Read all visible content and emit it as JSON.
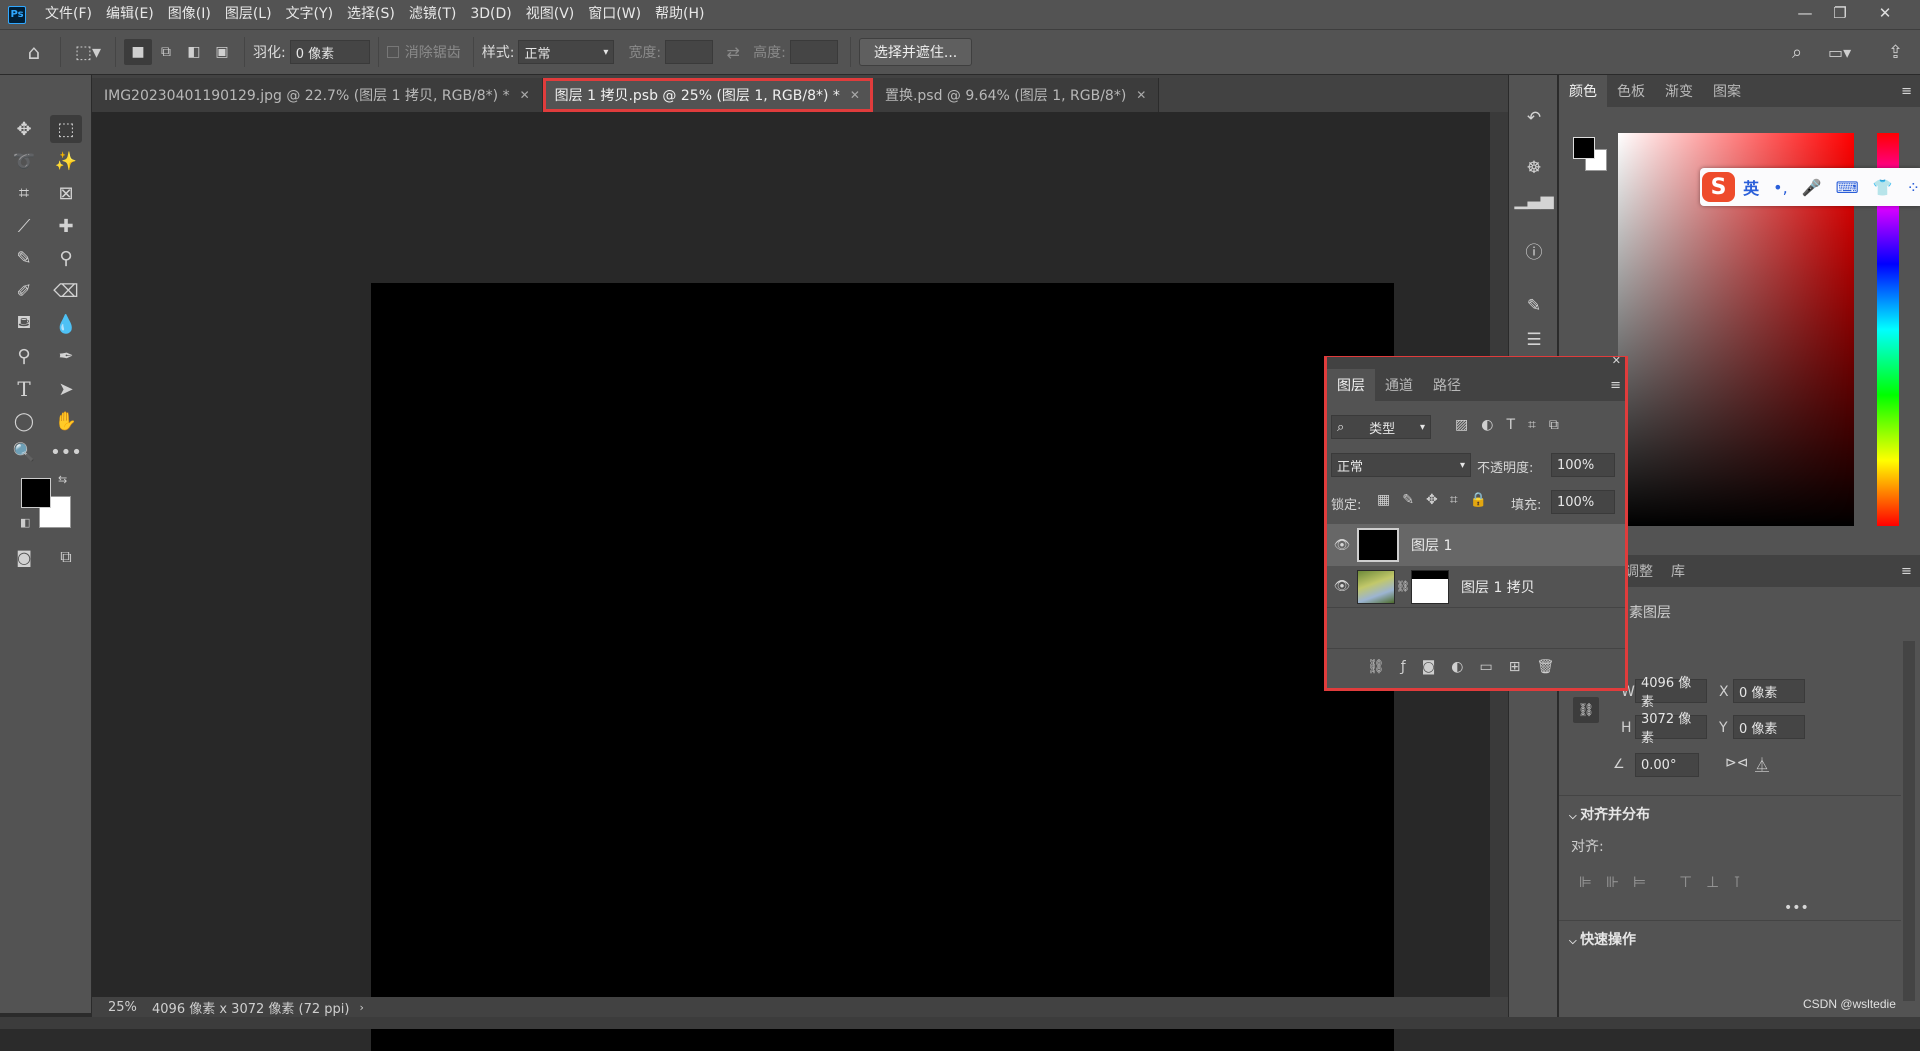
{
  "app": {
    "logo": "Ps"
  },
  "menu": [
    "文件(F)",
    "编辑(E)",
    "图像(I)",
    "图层(L)",
    "文字(Y)",
    "选择(S)",
    "滤镜(T)",
    "3D(D)",
    "视图(V)",
    "窗口(W)",
    "帮助(H)"
  ],
  "options": {
    "feather_label": "羽化:",
    "feather_value": "0 像素",
    "antialias_label": "消除锯齿",
    "style_label": "样式:",
    "style_value": "正常",
    "width_label": "宽度:",
    "height_label": "高度:",
    "select_mask_button": "选择并遮住..."
  },
  "tabs": [
    {
      "label": "IMG20230401190129.jpg @ 22.7% (图层 1 拷贝, RGB/8*) *"
    },
    {
      "label": "图层 1 拷贝.psb @ 25% (图层 1, RGB/8*) *"
    },
    {
      "label": "置换.psd @ 9.64% (图层 1, RGB/8*)"
    }
  ],
  "status": {
    "zoom": "25%",
    "doc_size": "4096 像素 x 3072 像素 (72 ppi)"
  },
  "color_panel": {
    "tabs": [
      "颜色",
      "色板",
      "渐变",
      "图案"
    ]
  },
  "ime": {
    "mode": "英"
  },
  "layers_panel": {
    "tabs": [
      "图层",
      "通道",
      "路径"
    ],
    "filter_label": "类型",
    "blend_mode": "正常",
    "opacity_label": "不透明度:",
    "opacity_value": "100%",
    "lock_label": "锁定:",
    "fill_label": "填充:",
    "fill_value": "100%",
    "layers": [
      {
        "name": "图层 1"
      },
      {
        "name": "图层 1 拷贝"
      }
    ]
  },
  "properties": {
    "tabs": [
      "调整",
      "库"
    ],
    "title": "素图层",
    "w_label": "W",
    "w_value": "4096 像素",
    "h_label": "H",
    "h_value": "3072 像素",
    "x_label": "X",
    "x_value": "0 像素",
    "y_label": "Y",
    "y_value": "0 像素",
    "angle_value": "0.00°",
    "align_section": "对齐并分布",
    "align_label": "对齐:",
    "quick_section": "快速操作"
  },
  "watermark": "CSDN @wsltedie",
  "colors": {
    "highlight": "#e03c3c",
    "panel": "#535353",
    "canvas_bg": "#282828"
  }
}
